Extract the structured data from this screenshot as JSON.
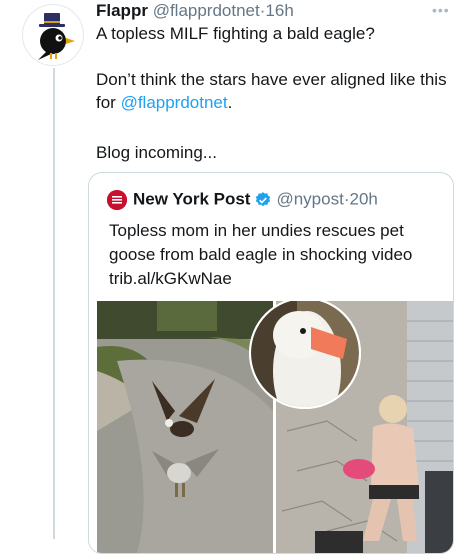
{
  "tweet": {
    "name": "Flappr",
    "handle": "@flapprdotnet",
    "dot": "·",
    "time": "16h",
    "line1": "A topless MILF fighting a bald eagle?",
    "line2_prefix": "Don’t think the stars have ever aligned like this for ",
    "line2_mention": "@flapprdotnet",
    "line2_suffix": ".",
    "line3": "Blog incoming..."
  },
  "quote": {
    "name": "New York Post",
    "handle": "@nypost",
    "dot": "·",
    "time": "20h",
    "text": "Topless mom in her undies rescues pet goose from bald eagle in shocking video trib.al/kGKwNae",
    "logo_text": "NEW YORK POST"
  },
  "colors": {
    "link": "#1da1f2",
    "verified": "#1da1f2",
    "nypost_red": "#c8102e"
  },
  "icons": [
    "avatar-bird",
    "more-icon",
    "verified-icon",
    "nypost-logo"
  ]
}
